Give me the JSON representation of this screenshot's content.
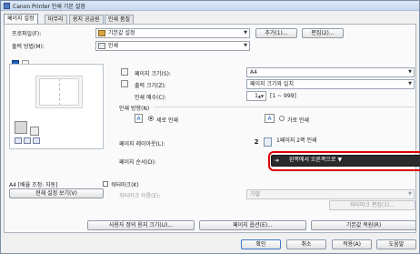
{
  "window": {
    "title": "Canon Printer 인쇄 기본 설정"
  },
  "tabs": [
    {
      "label": "페이지 설정"
    },
    {
      "label": "마무리"
    },
    {
      "label": "용지 공급원"
    },
    {
      "label": "인쇄 품질"
    }
  ],
  "profile": {
    "label": "프로파일(F):",
    "value": "기본값 설정",
    "add_label": "추가(1)...",
    "edit_label": "편집(2)..."
  },
  "output_method": {
    "label": "출력 방법(M):",
    "value": "인쇄"
  },
  "page_size": {
    "label": "페이지 크기(S):",
    "value": "A4"
  },
  "output_size": {
    "label": "출력 크기(Z):",
    "value": "페이지 크기와 일치"
  },
  "copies": {
    "label": "인쇄 매수(C):",
    "value": "1",
    "range": "[1 ~ 999]"
  },
  "orientation": {
    "label": "인쇄 방향(N)",
    "portrait": "세로 인쇄",
    "landscape": "가로 인쇄",
    "selected": "portrait"
  },
  "page_layout": {
    "label": "페이지 레이아웃(L):",
    "value": "1페이지 2쪽 인쇄",
    "icon_text": "2"
  },
  "page_order": {
    "label": "페이지 순서(D):",
    "value": "왼쪽에서 오른쪽으로"
  },
  "preview": {
    "caption": "A4 [배율 조정: 자동]",
    "view_settings_label": "현재 설정 보기(V)"
  },
  "watermark": {
    "label": "워터마크(K)",
    "name_label": "워터마크 이름(E):",
    "value": "기밀",
    "edit_label": "워터마크 편집(1)..."
  },
  "bottom_buttons": {
    "custom_paper": "사용자 정의 용지 크기(U)...",
    "page_options": "페이지 옵션(E)...",
    "restore_defaults": "기본값 복원(R)"
  },
  "dialog_buttons": {
    "ok": "확인",
    "cancel": "취소",
    "apply": "적용(A)",
    "help": "도움말"
  },
  "colors": {
    "highlight": "#e00000",
    "accent": "#1f5fbf"
  }
}
